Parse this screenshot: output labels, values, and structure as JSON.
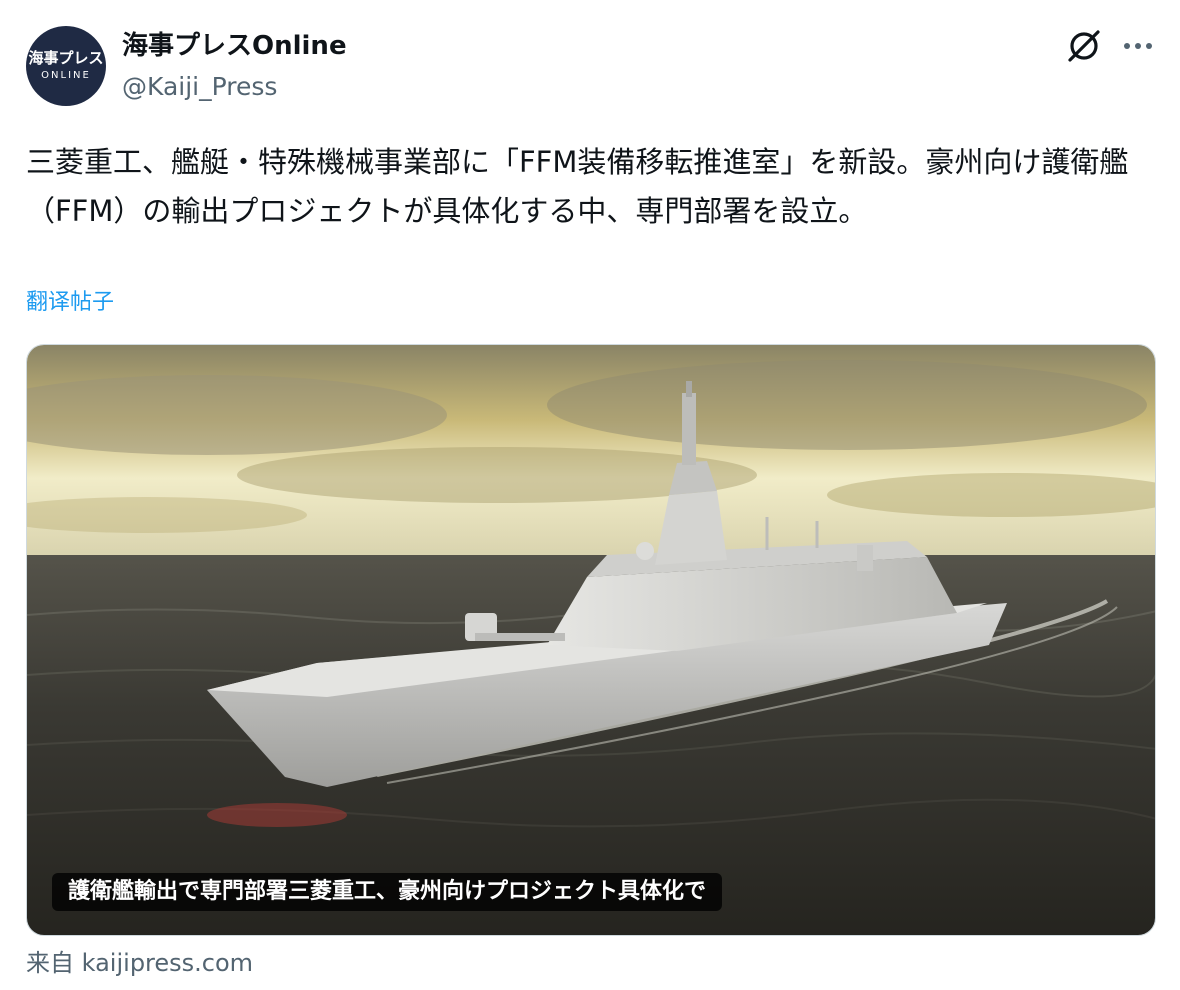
{
  "account": {
    "avatar_line1": "海事プレス",
    "avatar_line2": "ONLINE",
    "display_name": "海事プレスOnline",
    "handle": "@Kaiji_Press"
  },
  "header_icons": [
    "grok-icon",
    "more-options-icon"
  ],
  "tweet": {
    "text": "三菱重工、艦艇・特殊機械事業部に「FFM装備移転推進室」を新設。豪州向け護衛艦（FFM）の輸出プロジェクトが具体化する中、専門部署を設立。",
    "translate_label": "翻译帖子"
  },
  "card": {
    "image_caption": "護衛艦輸出で専門部署三菱重工、豪州向けプロジェクト具体化で",
    "source_label": "来自 kaijipress.com"
  },
  "colors": {
    "link": "#1d9bf0",
    "secondary_text": "#536471",
    "avatar_bg": "#1f2a44",
    "border": "#cfd9de"
  }
}
